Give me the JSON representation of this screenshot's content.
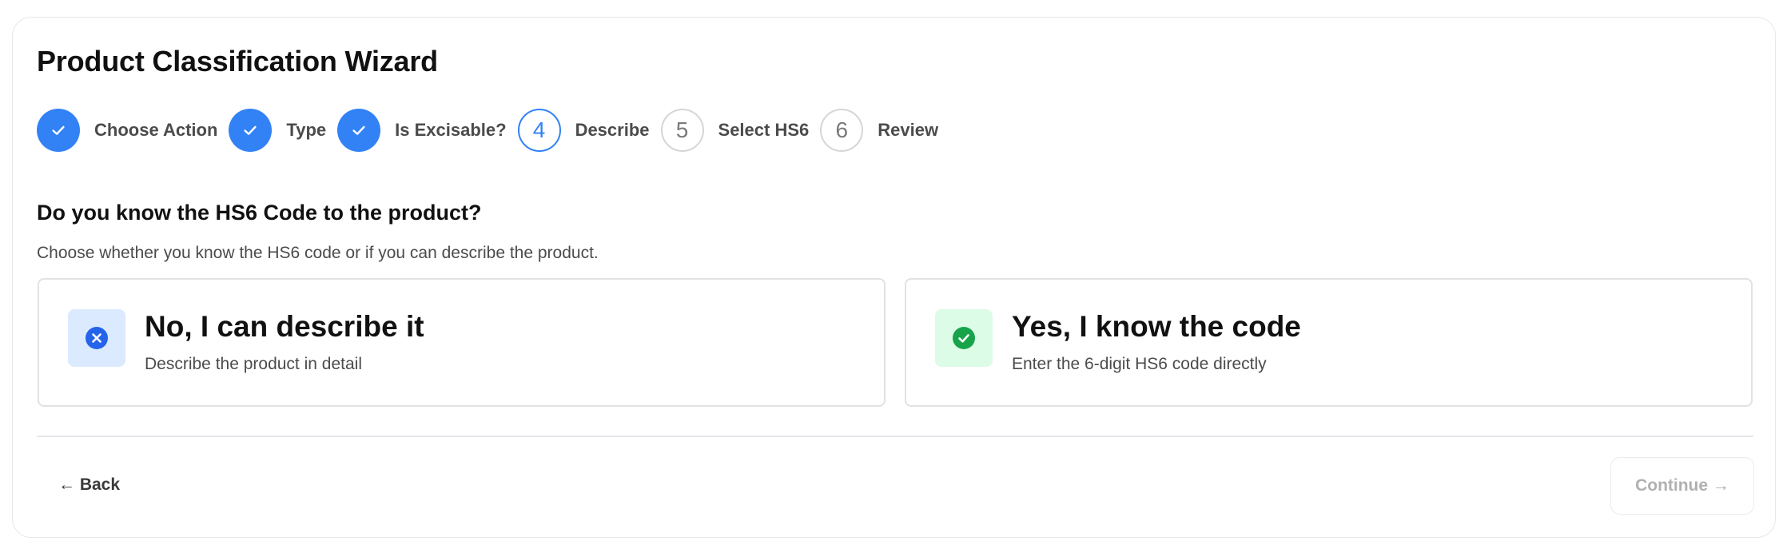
{
  "wizard": {
    "title": "Product Classification Wizard"
  },
  "stepper": {
    "steps": [
      {
        "number": "1",
        "label": "Choose Action",
        "state": "done"
      },
      {
        "number": "2",
        "label": "Type",
        "state": "done"
      },
      {
        "number": "3",
        "label": "Is Excisable?",
        "state": "done"
      },
      {
        "number": "4",
        "label": "Describe",
        "state": "active"
      },
      {
        "number": "5",
        "label": "Select HS6",
        "state": "todo"
      },
      {
        "number": "6",
        "label": "Review",
        "state": "todo"
      }
    ]
  },
  "question": {
    "heading": "Do you know the HS6 Code to the product?",
    "subtitle": "Choose whether you know the HS6 code or if you can describe the product."
  },
  "options": {
    "describe": {
      "title": "No, I can describe it",
      "description": "Describe the product in detail",
      "icon": "x-circle-icon"
    },
    "know_code": {
      "title": "Yes, I know the code",
      "description": "Enter the 6-digit HS6 code directly",
      "icon": "check-circle-icon"
    }
  },
  "footer": {
    "back_label": "← Back",
    "continue_label": "Continue →",
    "continue_disabled": true
  },
  "colors": {
    "accent": "#3282f6",
    "success": "#16a34a",
    "error_icon": "#2563eb",
    "muted_border": "#d6d6d6"
  }
}
